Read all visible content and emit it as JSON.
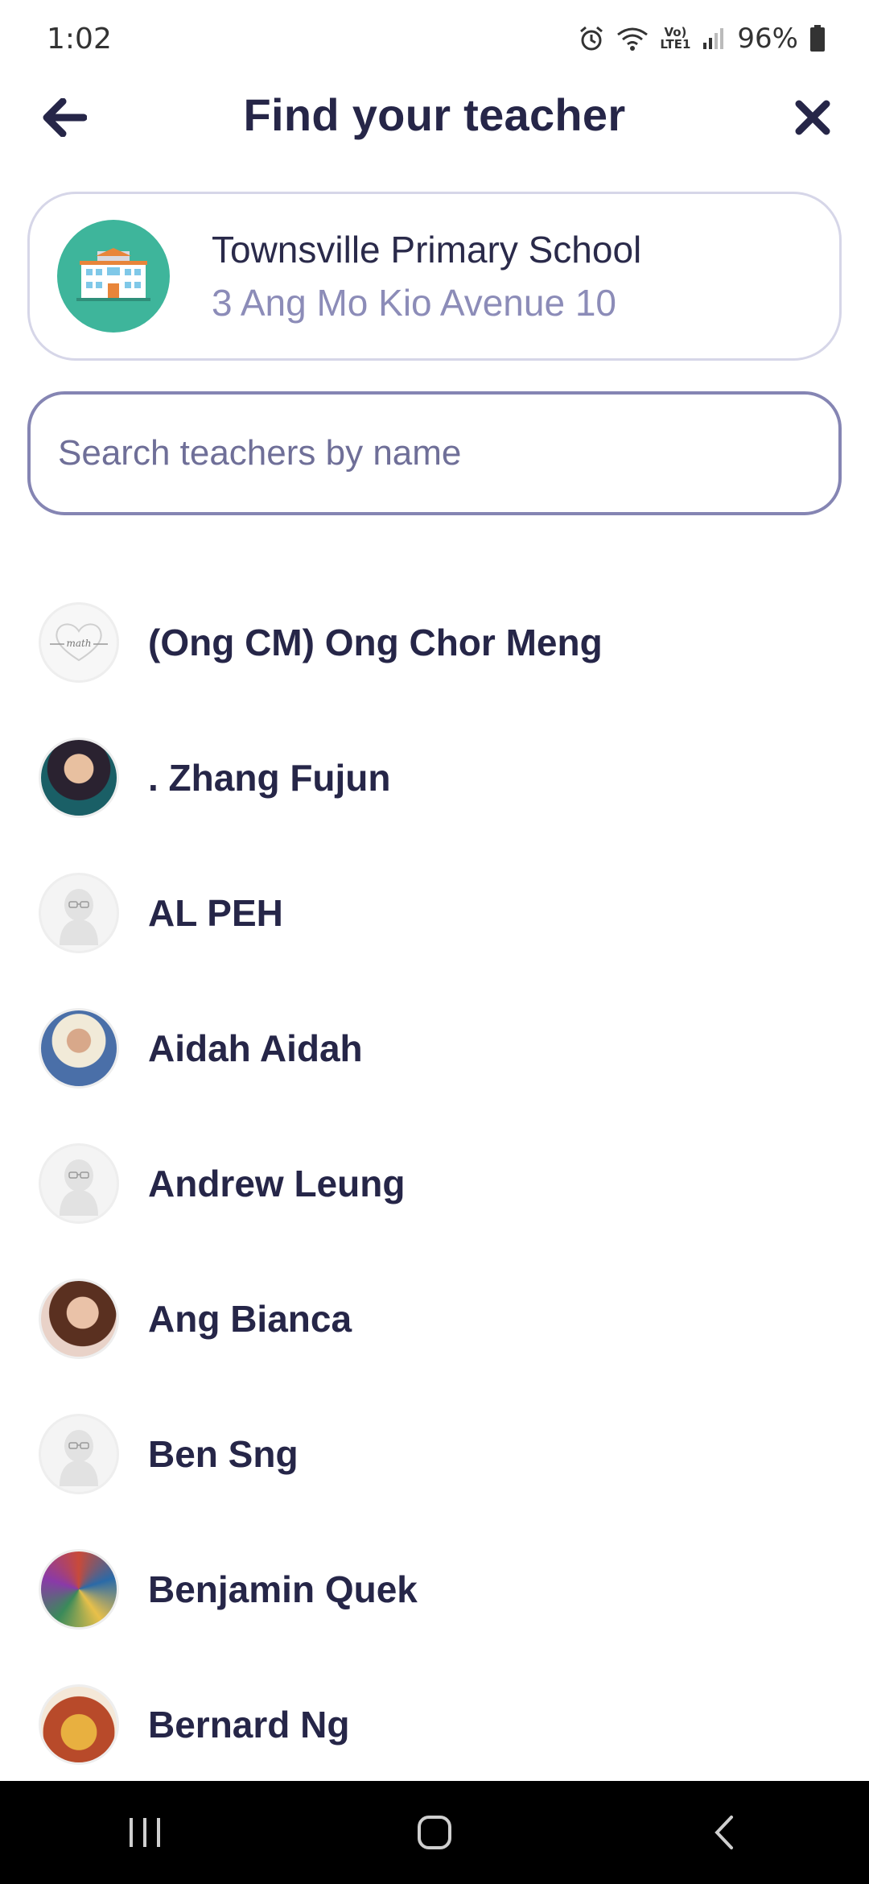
{
  "status_bar": {
    "time": "1:02",
    "network_label_top": "Vo)",
    "network_label_bottom": "LTE1",
    "battery": "96%"
  },
  "header": {
    "title": "Find your teacher"
  },
  "school": {
    "name": "Townsville Primary School",
    "address": "3 Ang Mo Kio Avenue 10"
  },
  "search": {
    "placeholder": "Search teachers by name",
    "value": ""
  },
  "teachers": [
    {
      "name": "(Ong CM) Ong Chor Meng",
      "avatar": "math-heart-icon"
    },
    {
      "name": ". Zhang Fujun",
      "avatar": "photo"
    },
    {
      "name": "AL PEH",
      "avatar": "default-avatar-icon"
    },
    {
      "name": "Aidah Aidah",
      "avatar": "photo"
    },
    {
      "name": "Andrew Leung",
      "avatar": "default-avatar-icon"
    },
    {
      "name": "Ang Bianca",
      "avatar": "photo"
    },
    {
      "name": "Ben Sng",
      "avatar": "default-avatar-icon"
    },
    {
      "name": "Benjamin Quek",
      "avatar": "photo"
    },
    {
      "name": "Bernard Ng",
      "avatar": "photo"
    }
  ],
  "colors": {
    "accent": "#8585b3",
    "school_avatar": "#3eb59b",
    "title": "#262648",
    "address": "#8c8cb8"
  }
}
